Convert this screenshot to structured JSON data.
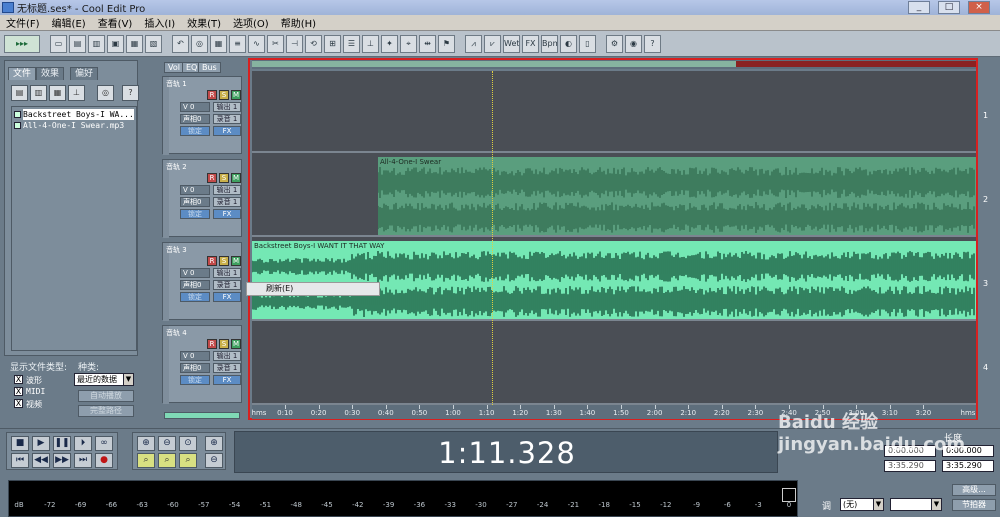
{
  "window": {
    "title": "无标题.ses* - Cool Edit Pro",
    "controls": [
      "_",
      "□",
      "×"
    ]
  },
  "menu": [
    "文件(F)",
    "编辑(E)",
    "查看(V)",
    "插入(I)",
    "效果(T)",
    "选项(O)",
    "帮助(H)"
  ],
  "toolbar": {
    "right_labels": [
      "Wet",
      "FX",
      "Bpm"
    ]
  },
  "organizer": {
    "tabs": [
      "文件",
      "效果",
      "偏好"
    ],
    "files": [
      {
        "name": "Backstreet Boys-I WA...",
        "selected": true
      },
      {
        "name": "All-4-One-I Swear.mp3",
        "selected": false
      }
    ],
    "filter_label": "显示文件类型:",
    "sort_label": "种类:",
    "sort_value": "最近的数据",
    "types": [
      {
        "label": "波形",
        "checked": "X"
      },
      {
        "label": "MIDI",
        "checked": "X"
      },
      {
        "label": "视频",
        "checked": "X"
      }
    ],
    "auto_play": "自动播放",
    "full_path": "完整路径"
  },
  "track_controls": {
    "tabs": [
      "Vol",
      "EQ",
      "Bus"
    ],
    "tracks": [
      {
        "name": "音轨 1",
        "vol": "V 0",
        "pan": "声相0",
        "out": "输出 1",
        "rec": "录音 1",
        "lock": "锁定",
        "fx": "FX"
      },
      {
        "name": "音轨 2",
        "vol": "V 0",
        "pan": "声相0",
        "out": "输出 1",
        "rec": "录音 1",
        "lock": "锁定",
        "fx": "FX"
      },
      {
        "name": "音轨 3",
        "vol": "V 0",
        "pan": "声相0",
        "out": "输出 1",
        "rec": "录音 1",
        "lock": "锁定",
        "fx": "FX"
      },
      {
        "name": "音轨 4",
        "vol": "V 0",
        "pan": "声相0",
        "out": "输出 1",
        "rec": "录音 1",
        "lock": "锁定",
        "fx": "FX"
      }
    ],
    "rsm": [
      "R",
      "S",
      "M"
    ]
  },
  "tracks_view": {
    "track_numbers": [
      "1",
      "2",
      "3",
      "4"
    ],
    "clips": [
      {
        "track": 2,
        "label": "All-4-One-I Swear",
        "color": "#5a9e7e"
      },
      {
        "track": 3,
        "label": "Backstreet Boys-I WANT IT THAT WAY",
        "color": "#74e8b4"
      }
    ],
    "context_menu": "刷新(E)"
  },
  "ruler": {
    "start": "hms",
    "end": "hms",
    "labels": [
      "0:10",
      "0:20",
      "0:30",
      "0:40",
      "0:50",
      "1:00",
      "1:10",
      "1:20",
      "1:30",
      "1:40",
      "1:50",
      "2:00",
      "2:10",
      "2:20",
      "2:30",
      "2:40",
      "2:50",
      "3:00",
      "3:10",
      "3:20"
    ]
  },
  "transport": {
    "time": "1:11.328"
  },
  "length_panel": {
    "label": "长度",
    "values": [
      "0:00.000",
      "3:35.290"
    ],
    "partial_values": [
      "0:00.000",
      "3:35.290"
    ]
  },
  "bottom_controls": {
    "tone_label": "调",
    "tone_value": "(无)",
    "btn1": "高级...",
    "btn2": "节拍器"
  },
  "meter": {
    "labels": [
      "dB",
      "-72",
      "-69",
      "-66",
      "-63",
      "-60",
      "-57",
      "-54",
      "-51",
      "-48",
      "-45",
      "-42",
      "-39",
      "-36",
      "-33",
      "-30",
      "-27",
      "-24",
      "-21",
      "-18",
      "-15",
      "-12",
      "-9",
      "-6",
      "-3",
      "0"
    ]
  },
  "watermark": "Baidu 经验 jingyan.baidu.com"
}
